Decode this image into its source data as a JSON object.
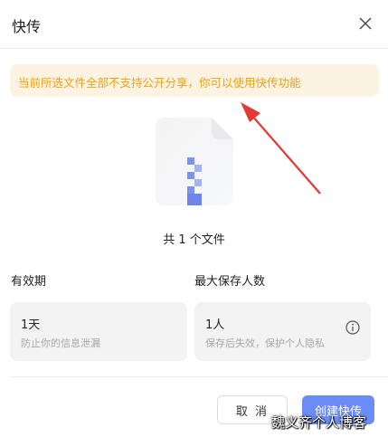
{
  "dialog": {
    "title": "快传",
    "notice": "当前所选文件全部不支持公开分享，你可以使用快传功能",
    "file_count": "共 1 个文件"
  },
  "validity": {
    "label": "有效期",
    "value": "1天",
    "hint": "防止你的信息泄漏"
  },
  "max_savers": {
    "label": "最大保存人数",
    "value": "1人",
    "hint": "保存后失效，保护个人隐私"
  },
  "actions": {
    "cancel_label": "取 消",
    "create_label": "创建快传"
  },
  "watermark": "魏义齐个人博客",
  "icons": {
    "close": "close-icon",
    "info": "info-icon",
    "file": "zip-file-icon",
    "arrow": "annotation-arrow"
  },
  "colors": {
    "notice_bg": "#fdf3e3",
    "notice_text": "#f0a014",
    "primary": "#6b8bf5",
    "arrow": "#e53935"
  }
}
